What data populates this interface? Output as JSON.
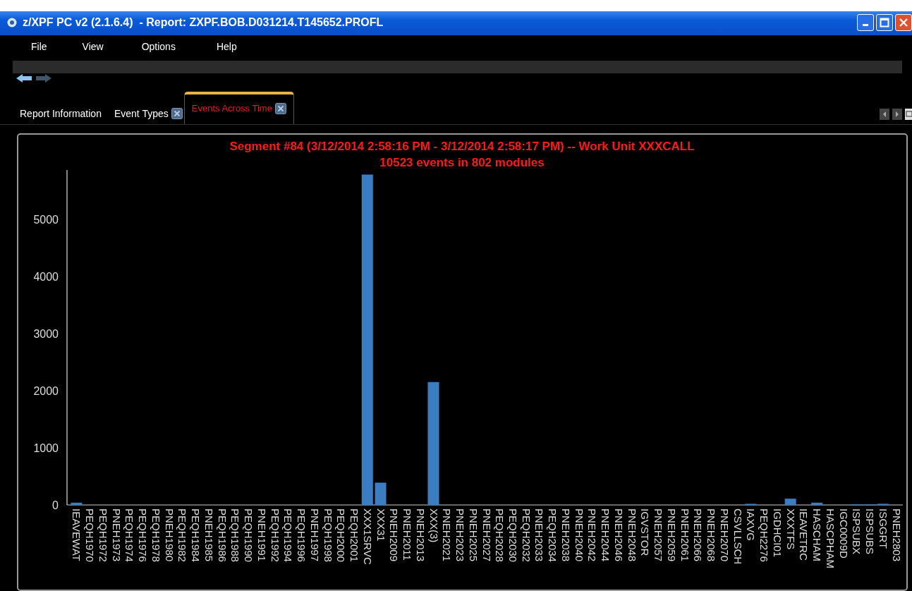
{
  "window": {
    "title": "z/XPF PC v2 (2.1.6.4)  - Report: ZXPF.BOB.D031214.T145652.PROFL"
  },
  "menu": [
    "File",
    "View",
    "Options",
    "Help"
  ],
  "navigation": [
    {
      "kind": "back",
      "disabled": false
    },
    {
      "kind": "forward",
      "disabled": true
    }
  ],
  "tabs": [
    {
      "label": "Report Information",
      "selected": false,
      "closable": false
    },
    {
      "label": "Event Types",
      "selected": false,
      "closable": true
    },
    {
      "label": "Events Across Time",
      "selected": true,
      "closable": true
    }
  ],
  "chart": {
    "subtitle": "10523 events in 802 modules",
    "chart_data": {
      "type": "bar",
      "title": "Segment #84 (3/12/2014 2:58:16 PM - 3/12/2014 2:58:17 PM) -- Work Unit XXXCALL",
      "categories": [
        "IEAVEWAT",
        "PEQH1970",
        "PEQH1972",
        "PNEH1973",
        "PEQH1974",
        "PEQH1976",
        "PEQH1978",
        "PNEH1980",
        "PEQH1982",
        "PEQH1984",
        "PNEH1985",
        "PEQH1986",
        "PEQH1988",
        "PEQH1990",
        "PNEH1991",
        "PEQH1992",
        "PEQH1994",
        "PEQH1996",
        "PNEH1997",
        "PEQH1998",
        "PEQH2000",
        "PEQH2001",
        "XXX1SRVC",
        "XXX31",
        "PNEH2009",
        "PNEH2011",
        "PNEH2013",
        "XXX(3)",
        "PNEH2021",
        "PNEH2023",
        "PNEH2025",
        "PNEH2027",
        "PEQH2028",
        "PEQH2030",
        "PEQH2032",
        "PNEH2033",
        "PEQH2034",
        "PNEH2038",
        "PNEH2040",
        "PNEH2042",
        "PNEH2044",
        "PNEH2046",
        "PNEH2048",
        "IGVSTOR",
        "PNEH2057",
        "PNEH2059",
        "PNEH2061",
        "PNEH2066",
        "PNEH2068",
        "PNEH2070",
        "CSVLLSCH",
        "IAXVG",
        "PEQH2276",
        "IGDHCI01",
        "XXXTFS",
        "IEAVETRC",
        "HASCHAM",
        "HASCPHAM",
        "IGC0009D",
        "ISPSUBX",
        "ISPSUBS",
        "ISGGRT",
        "PNEH2803"
      ],
      "series": [
        {
          "color": "#3a7dc0",
          "values": [
            40,
            0,
            0,
            0,
            0,
            0,
            0,
            0,
            0,
            0,
            0,
            0,
            0,
            0,
            0,
            0,
            0,
            0,
            0,
            0,
            0,
            0,
            5780,
            390,
            0,
            0,
            0,
            2150,
            0,
            0,
            0,
            0,
            0,
            0,
            0,
            0,
            0,
            0,
            0,
            0,
            0,
            0,
            0,
            0,
            0,
            0,
            0,
            0,
            0,
            0,
            0,
            20,
            0,
            0,
            110,
            0,
            40,
            0,
            0,
            10,
            10,
            20,
            0
          ]
        }
      ],
      "ylim": [
        0,
        5860
      ],
      "yticks": [
        0,
        1000,
        2000,
        3000,
        4000,
        5000
      ]
    }
  }
}
